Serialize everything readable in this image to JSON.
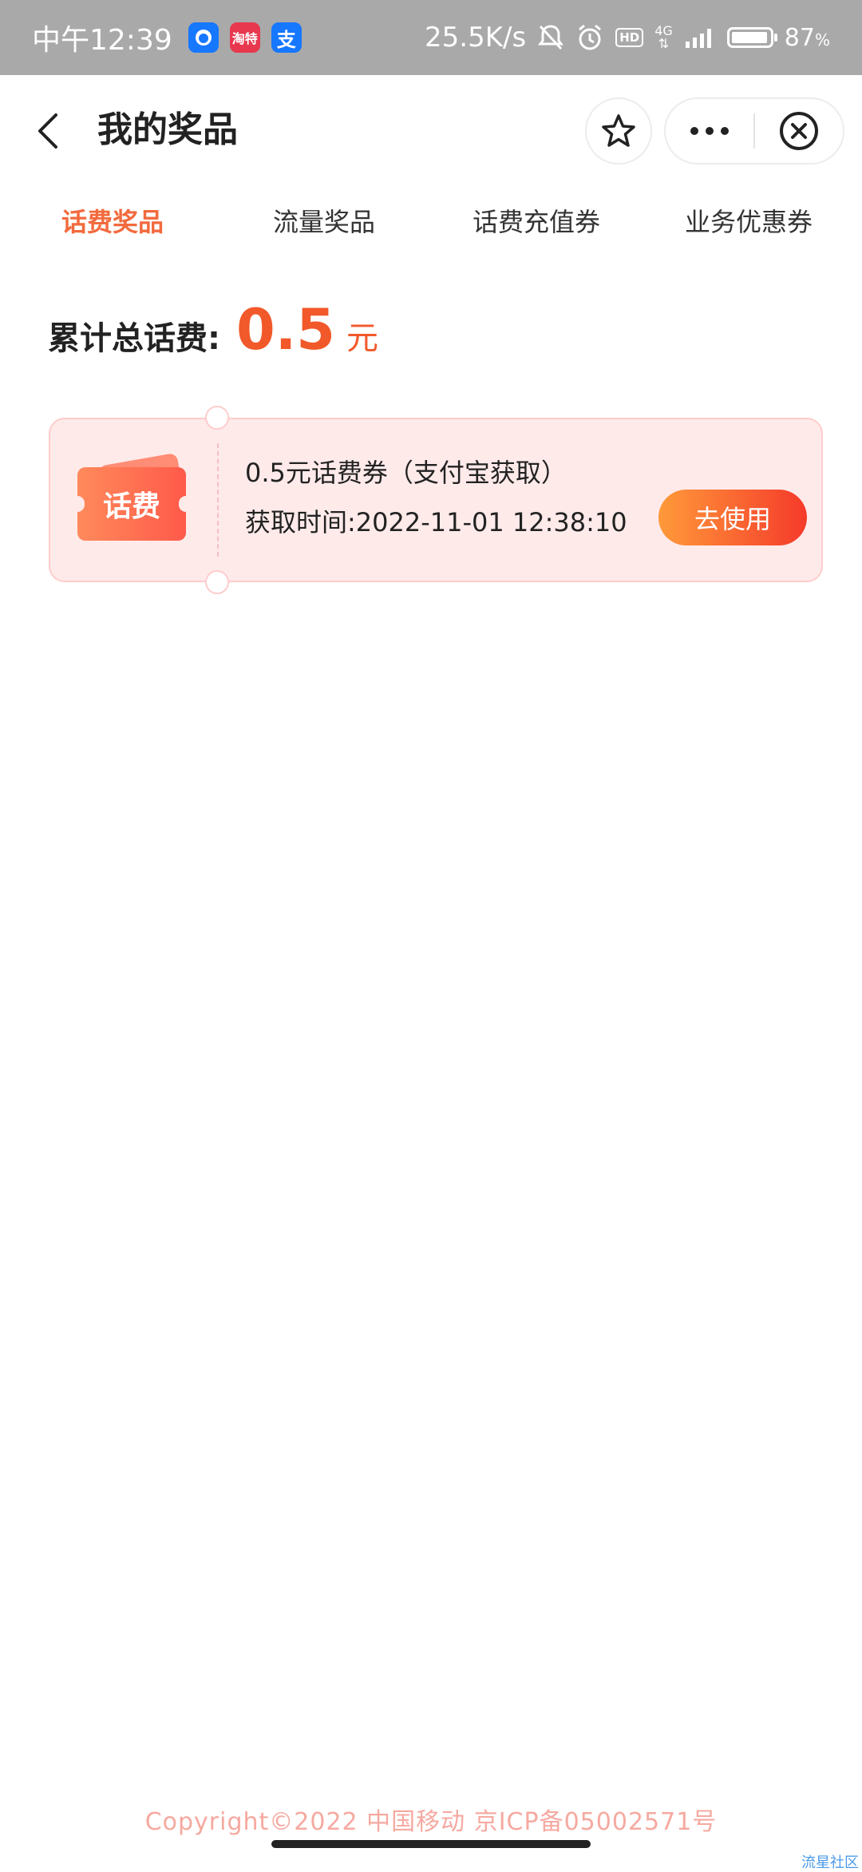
{
  "status_bar": {
    "time": "中午12:39",
    "apps": [
      "app-icon-1",
      "淘特",
      "支"
    ],
    "network_speed": "25.5K/s",
    "hd": "HD",
    "net_type": "4G",
    "battery": "87",
    "battery_unit": "%"
  },
  "header": {
    "title": "我的奖品"
  },
  "tabs": [
    {
      "label": "话费奖品",
      "active": true
    },
    {
      "label": "流量奖品",
      "active": false
    },
    {
      "label": "话费充值券",
      "active": false
    },
    {
      "label": "业务优惠券",
      "active": false
    }
  ],
  "total": {
    "label": "累计总话费:",
    "value": "0.5",
    "unit": "元"
  },
  "coupons": [
    {
      "badge": "话费",
      "title": "0.5元话费券（支付宝获取）",
      "time": "获取时间:2022-11-01  12:38:10",
      "button": "去使用"
    }
  ],
  "footer": {
    "copyright": "Copyright©2022  中国移动  京ICP备05002571号"
  },
  "watermark": "流星社区",
  "colors": {
    "accent": "#f26a3d",
    "status_bar": "#a9a9a9",
    "coupon_bg": "#ffeaea"
  }
}
